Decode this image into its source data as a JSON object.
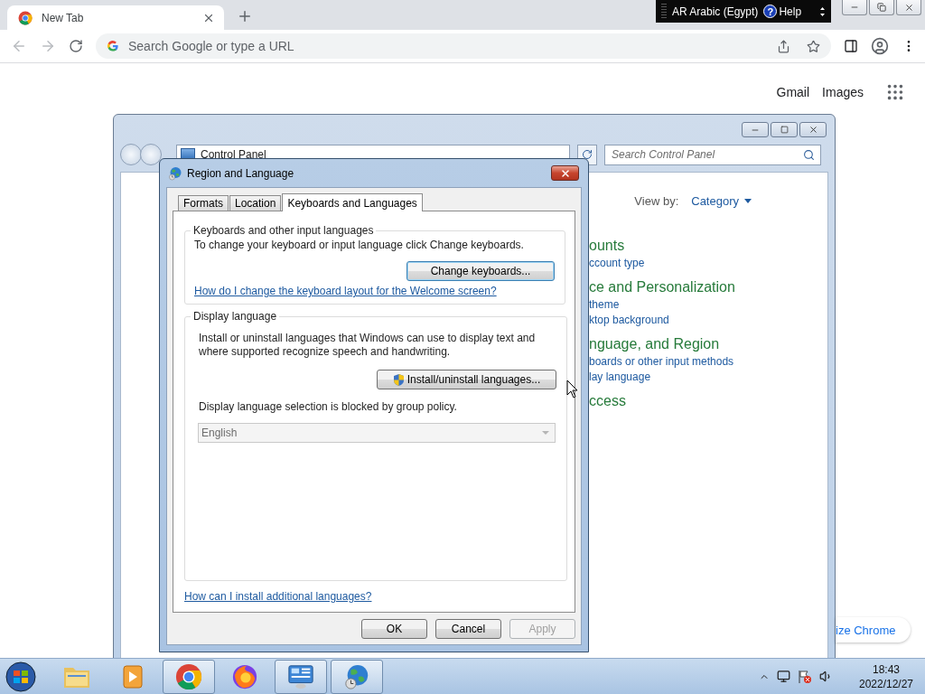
{
  "browser": {
    "tab": {
      "title": "New Tab",
      "selected": true
    },
    "ime_bar": {
      "language": "AR Arabic (Egypt)",
      "help_glyph": "?",
      "help": "Help"
    },
    "omnibox": {
      "placeholder": "Search Google or type a URL"
    },
    "page_links": [
      "Gmail",
      "Images"
    ],
    "customize_button": "ize Chrome"
  },
  "control_panel": {
    "breadcrumb": "Control Panel",
    "search": {
      "placeholder": "Search Control Panel"
    },
    "view_by": {
      "label": "View by:",
      "value": "Category"
    },
    "categories": [
      {
        "title": "ounts",
        "links": [
          "ccount type"
        ]
      },
      {
        "title": "ce and Personalization",
        "links": [
          "theme",
          "ktop background"
        ]
      },
      {
        "title": "nguage, and Region",
        "links": [
          "boards or other input methods",
          "lay language"
        ]
      },
      {
        "title": "ccess"
      }
    ]
  },
  "dialog": {
    "title": "Region and Language",
    "tabs": [
      {
        "label": "Formats",
        "selected": false
      },
      {
        "label": "Location",
        "selected": false
      },
      {
        "label": "Keyboards and Languages",
        "selected": true
      }
    ],
    "keyboards_group": {
      "legend": "Keyboards and other input languages",
      "text": "To change your keyboard or input language click Change keyboards.",
      "button": {
        "label": "Change keyboards...",
        "focused": true
      },
      "link": "How do I change the keyboard layout for the Welcome screen?"
    },
    "display_group": {
      "legend": "Display language",
      "text": "Install or uninstall languages that Windows can use to display text and where supported recognize speech and handwriting.",
      "button": {
        "label": "Install/uninstall languages...",
        "focused": false
      },
      "note": "Display language selection is blocked by group policy.",
      "select": {
        "value": "English",
        "disabled": true
      }
    },
    "help_link": "How can I install additional languages?",
    "buttons": [
      {
        "label": "OK",
        "disabled": false
      },
      {
        "label": "Cancel",
        "disabled": false
      },
      {
        "label": "Apply",
        "disabled": true
      }
    ]
  },
  "taskbar": {
    "apps": [
      {
        "kind": "folder",
        "running": false
      },
      {
        "kind": "media",
        "running": false
      },
      {
        "kind": "browser",
        "running": true
      },
      {
        "kind": "foxbrowser",
        "running": false
      },
      {
        "kind": "panel",
        "running": true
      },
      {
        "kind": "globe",
        "running": true
      }
    ],
    "clock": {
      "time": "18:43",
      "date": "2022/12/27"
    }
  }
}
